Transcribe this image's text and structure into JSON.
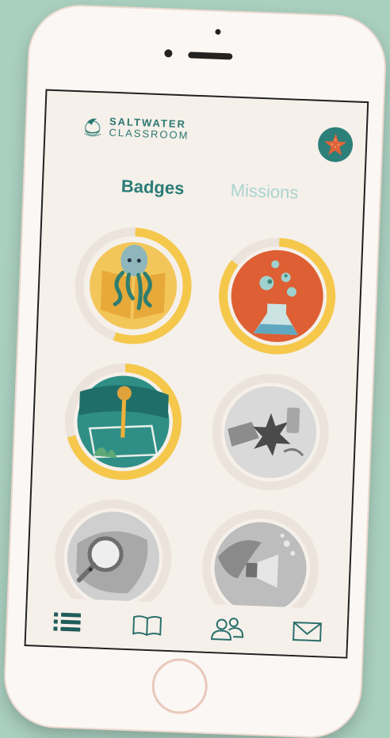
{
  "app": {
    "brand_line1": "SALTWATER",
    "brand_line2": "CLASSROOM"
  },
  "tabs": [
    {
      "label": "Badges",
      "active": true
    },
    {
      "label": "Missions",
      "active": false
    }
  ],
  "badges": [
    {
      "icon": "octopus-reading-icon",
      "progress": 0.55,
      "unlocked": true
    },
    {
      "icon": "flask-planets-icon",
      "progress": 0.85,
      "unlocked": true
    },
    {
      "icon": "ocean-sampling-icon",
      "progress": 0.7,
      "unlocked": true
    },
    {
      "icon": "ocean-trash-icon",
      "progress": 0,
      "unlocked": false
    },
    {
      "icon": "magnifier-creature-icon",
      "progress": 0,
      "unlocked": false
    },
    {
      "icon": "shark-megaphone-icon",
      "progress": 0,
      "unlocked": false
    }
  ],
  "bottom_nav": [
    {
      "name": "list-icon",
      "active": true
    },
    {
      "name": "book-icon",
      "active": false
    },
    {
      "name": "people-icon",
      "active": false
    },
    {
      "name": "mail-icon",
      "active": false
    }
  ],
  "colors": {
    "teal": "#2a7b76",
    "teal_light": "#a9d4cf",
    "progress_yellow": "#f5c84c",
    "track": "#ebe3dc",
    "background": "#f6f0ea"
  }
}
